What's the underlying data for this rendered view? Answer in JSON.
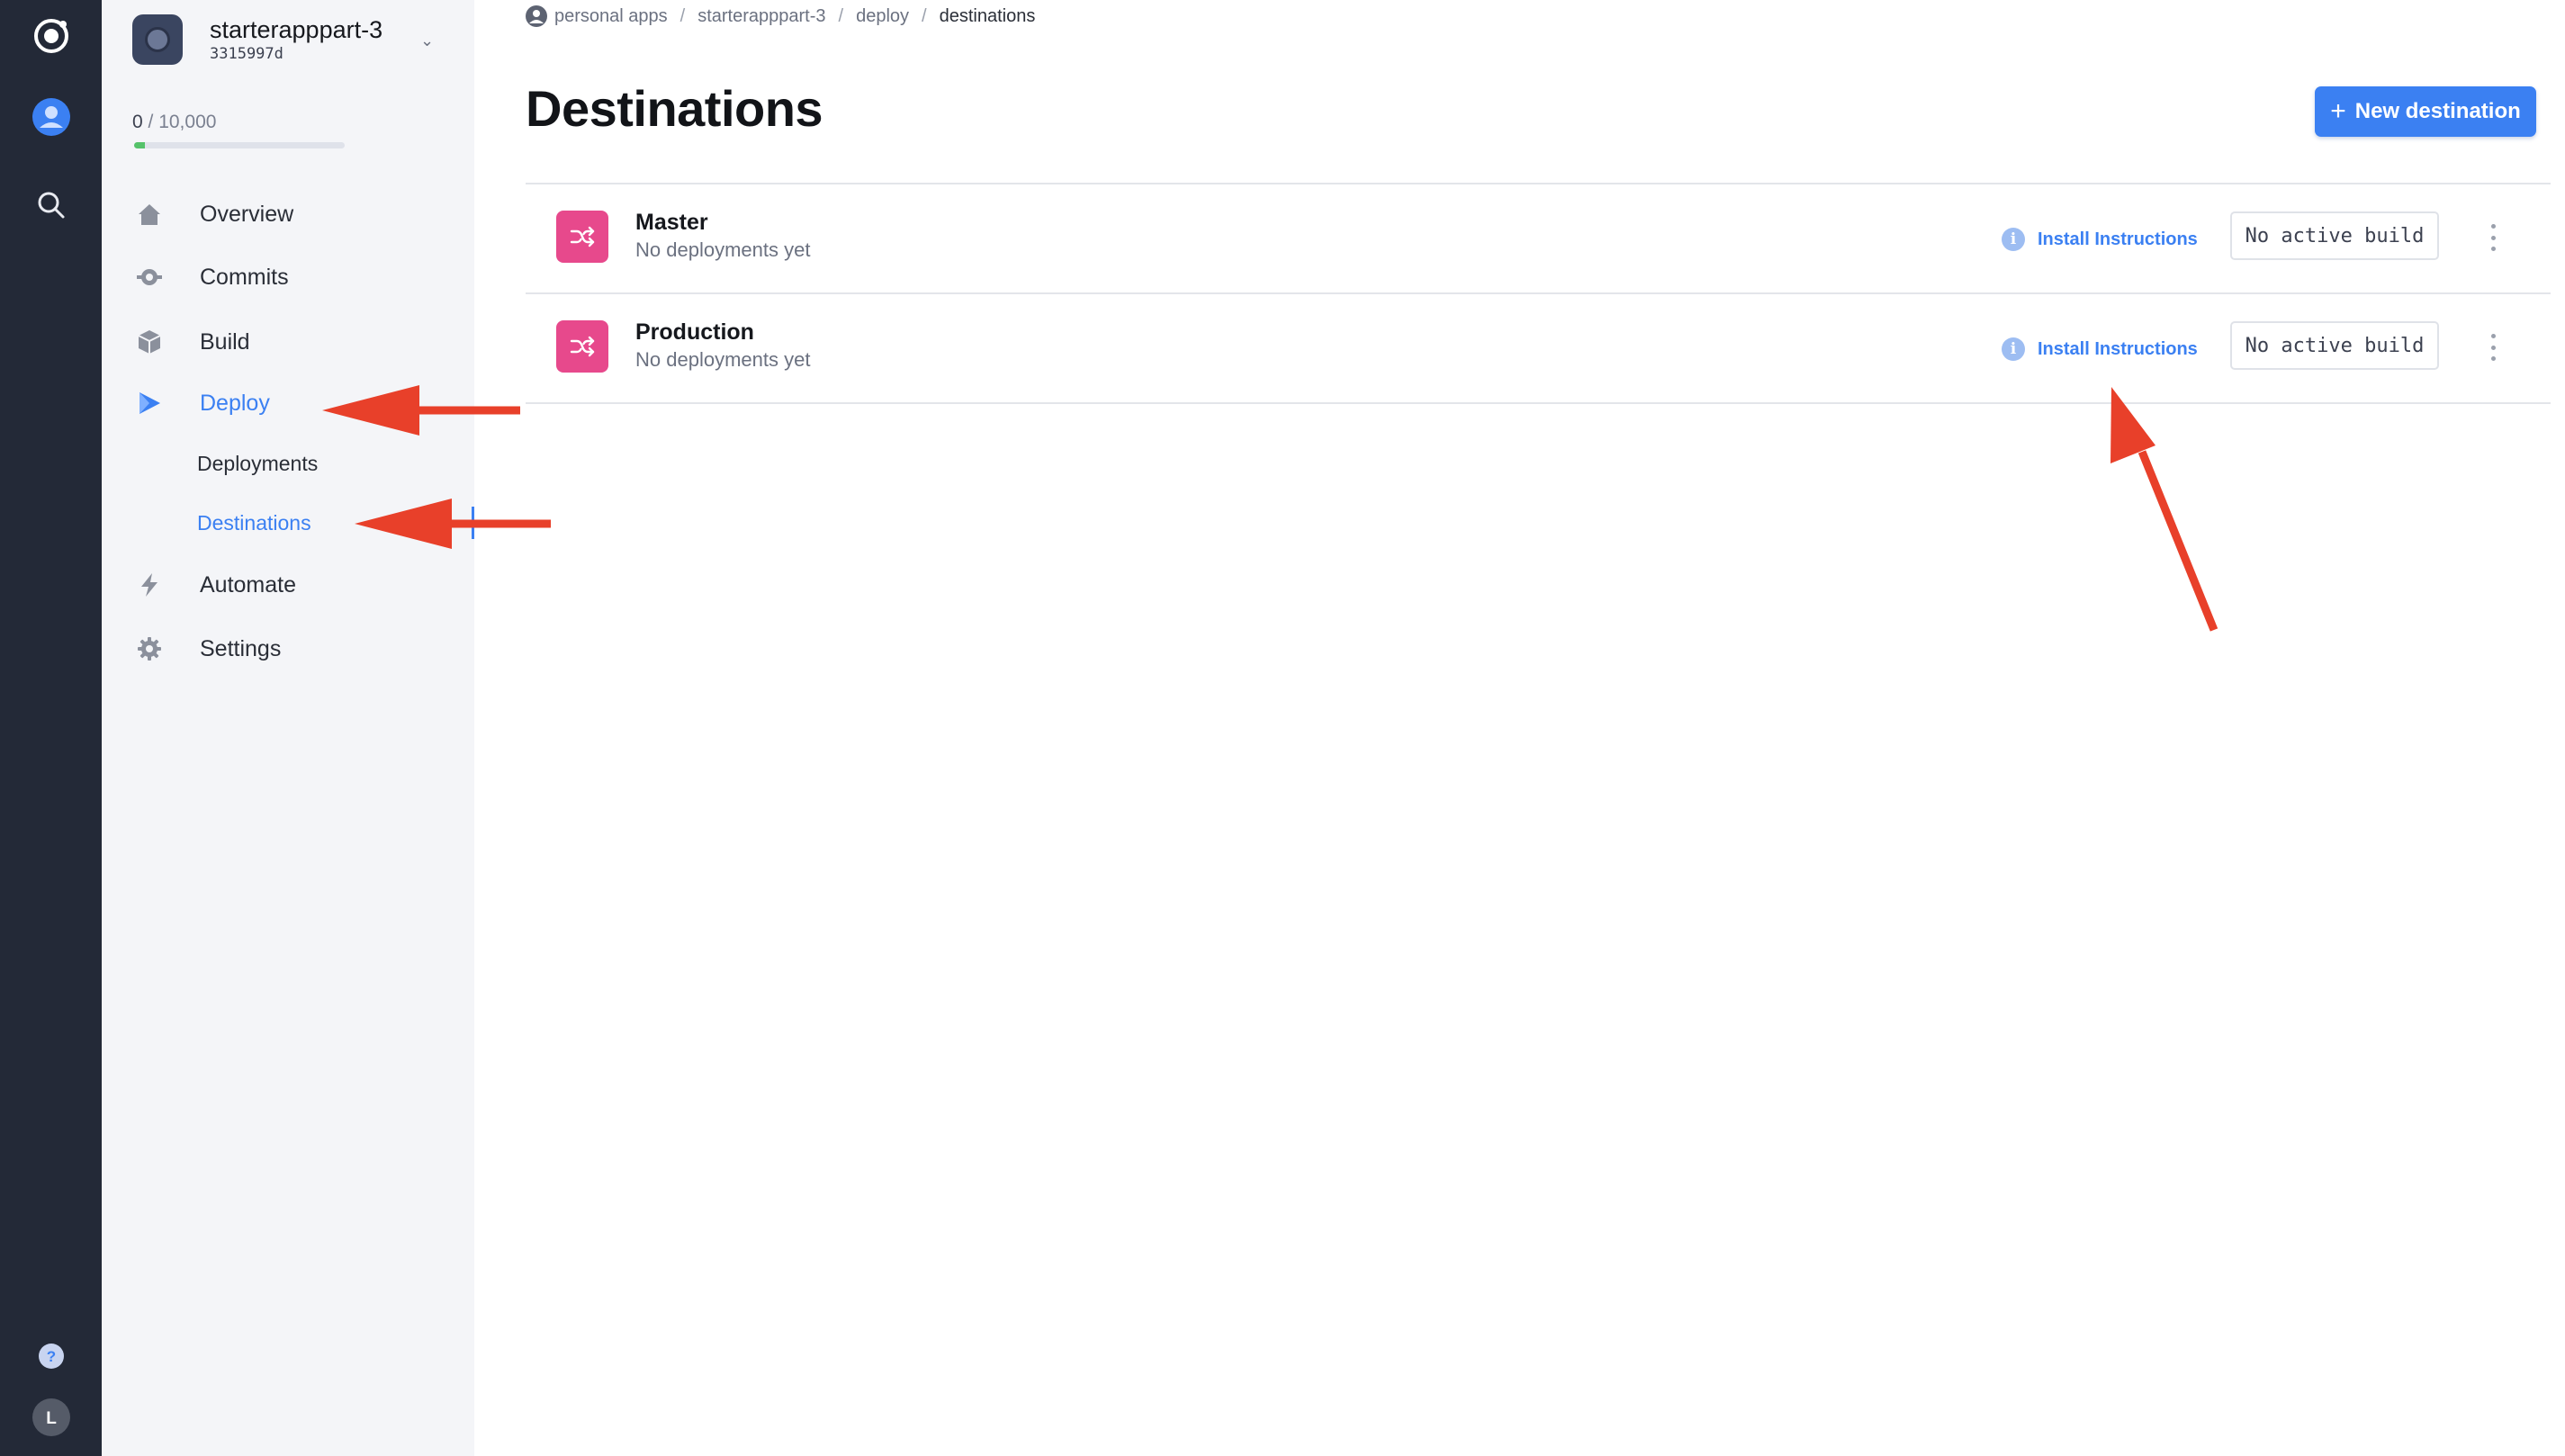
{
  "rail": {
    "icons": [
      "ionic-logo-icon",
      "user-avatar-icon",
      "search-icon",
      "help-icon",
      "profile-icon"
    ],
    "profile_initial": "L",
    "help_glyph": "?"
  },
  "app": {
    "name": "starterapppart-3",
    "id": "3315997d",
    "usage_used": "0",
    "usage_total": "10,000",
    "usage_fraction": 0.05
  },
  "nav": {
    "overview": "Overview",
    "commits": "Commits",
    "build": "Build",
    "deploy": "Deploy",
    "deployments": "Deployments",
    "destinations": "Destinations",
    "automate": "Automate",
    "settings": "Settings"
  },
  "breadcrumb": {
    "personal_apps": "personal apps",
    "app": "starterapppart-3",
    "section": "deploy",
    "current": "destinations",
    "separator": "/"
  },
  "page": {
    "title": "Destinations",
    "new_button": "New destination",
    "new_button_plus": "+"
  },
  "destinations": [
    {
      "name": "Master",
      "status": "No deployments yet",
      "install_label": "Install Instructions",
      "build_label": "No active build"
    },
    {
      "name": "Production",
      "status": "No deployments yet",
      "install_label": "Install Instructions",
      "build_label": "No active build"
    }
  ],
  "colors": {
    "rail_bg": "#232937",
    "panel_bg": "#f4f5f8",
    "accent": "#3b80f2",
    "destination_tile": "#e7498c",
    "annotation_arrow": "#e8402a",
    "usage_fill": "#55c26a"
  }
}
